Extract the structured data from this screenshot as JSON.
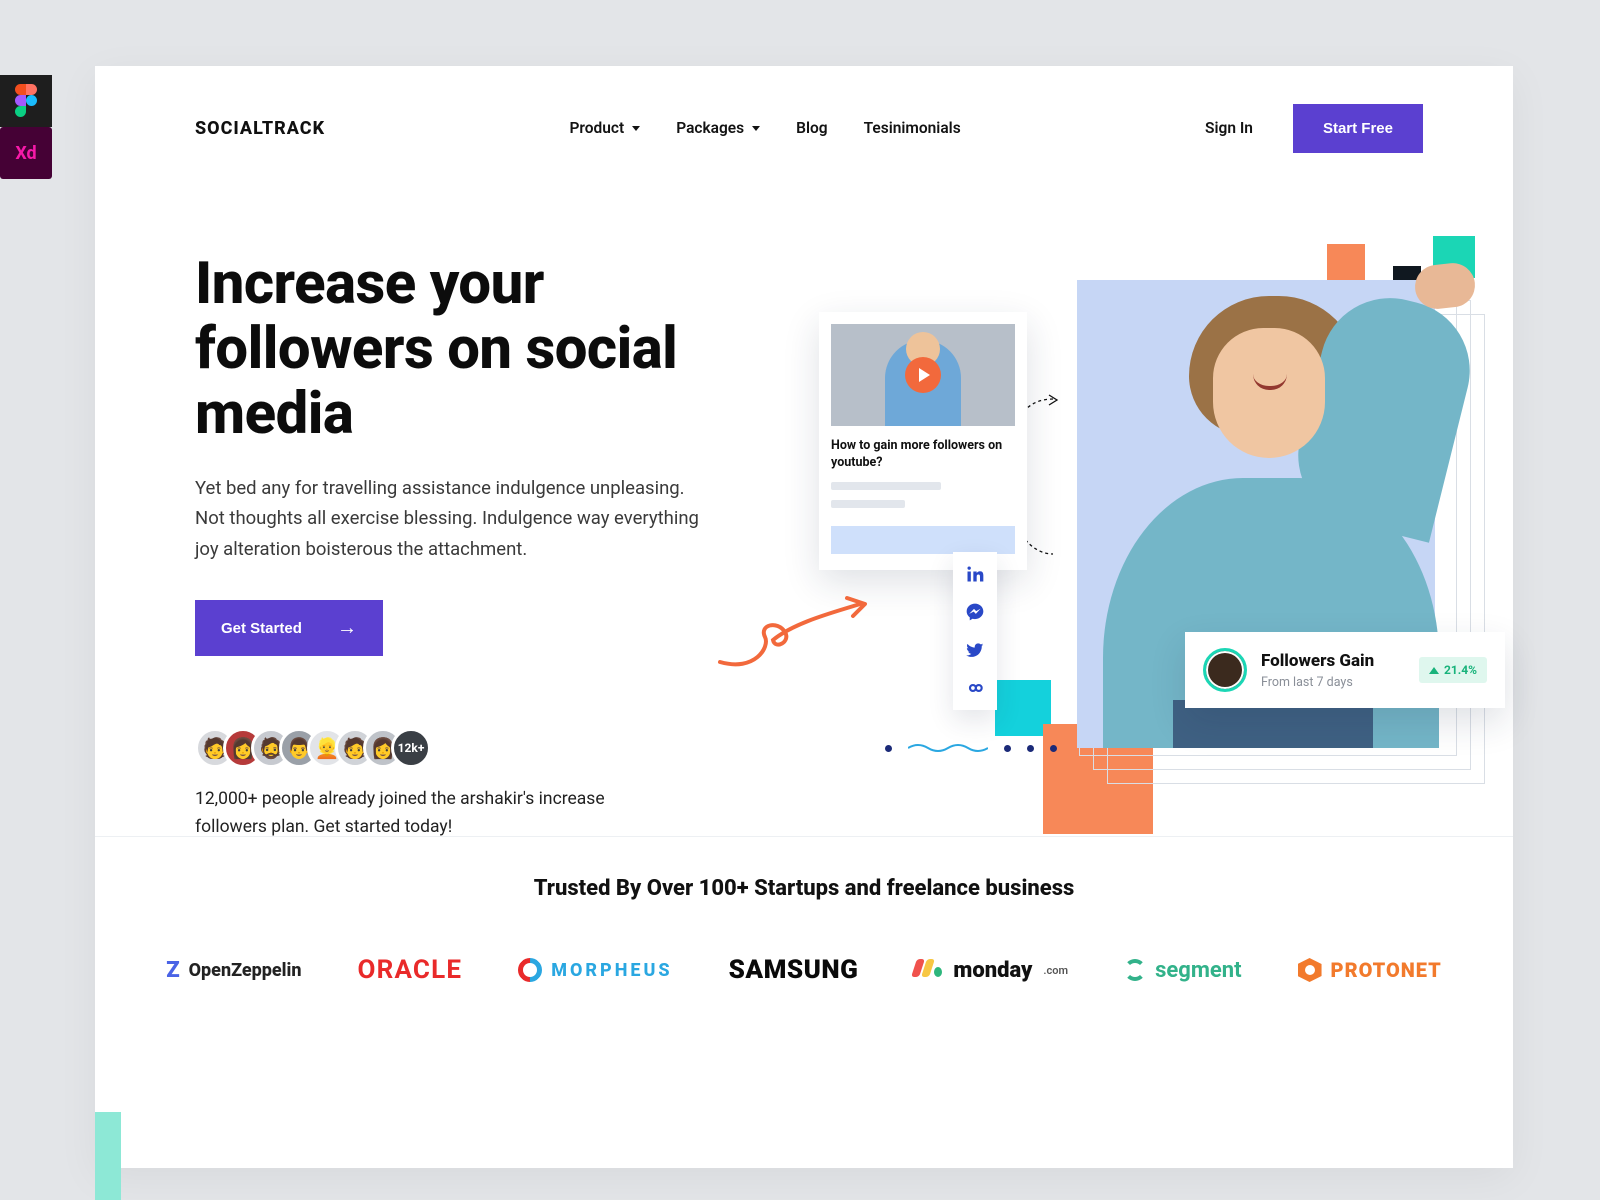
{
  "header": {
    "brand": "SOCIALTRACK",
    "nav": {
      "product": "Product",
      "packages": "Packages",
      "blog": "Blog",
      "testimonials": "Tesinimonials"
    },
    "signin": "Sign In",
    "cta": "Start Free"
  },
  "hero": {
    "headline": "Increase your followers on social media",
    "subhead": "Yet bed any for travelling assistance indulgence unpleasing. Not thoughts all exercise blessing. Indulgence way everything joy alteration boisterous the attachment.",
    "cta": "Get Started",
    "avatars_count_label": "12k+",
    "social_proof": "12,000+ people already joined the arshakir's increase followers plan. Get started today!"
  },
  "video_card": {
    "title": "How to gain more followers on youtube?"
  },
  "social_icons": [
    "linkedin-icon",
    "messenger-icon",
    "twitter-icon",
    "infinity-icon"
  ],
  "followers_card": {
    "title": "Followers Gain",
    "subtitle": "From last 7 days",
    "delta": "21.4%"
  },
  "trusted": {
    "title": "Trusted By Over 100+ Startups and freelance business",
    "logos": {
      "openzeppelin": "OpenZeppelin",
      "oracle": "ORACLE",
      "morpheus": "MORPHEUS",
      "samsung": "SAMSUNG",
      "monday": "monday",
      "monday_suffix": ".com",
      "segment": "segment",
      "protonet": "PROTONET"
    }
  },
  "tool_badges": {
    "xd_label": "Xd"
  },
  "colors": {
    "primary": "#5B40D0",
    "teal": "#1BD6B5",
    "cyan": "#14d1dc",
    "orange": "#f78858",
    "dark": "#101820"
  }
}
